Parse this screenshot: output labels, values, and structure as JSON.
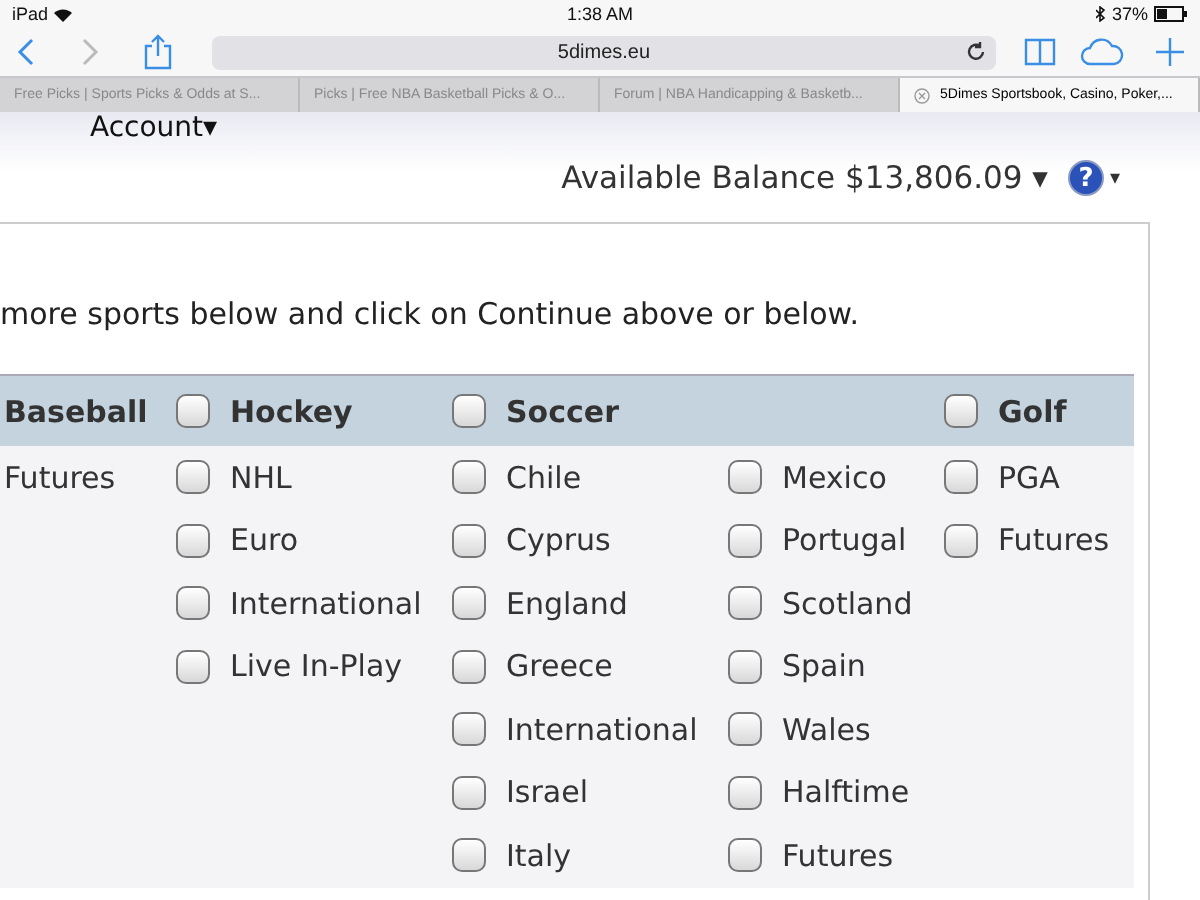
{
  "status_bar": {
    "device": "iPad",
    "time": "1:38 AM",
    "battery": "37%"
  },
  "toolbar": {
    "url": "5dimes.eu"
  },
  "tabs": [
    {
      "label": "Free Picks | Sports Picks & Odds at S...",
      "selected": false
    },
    {
      "label": "Picks | Free NBA Basketball Picks & O...",
      "selected": false
    },
    {
      "label": "Forum | NBA Handicapping & Basketb...",
      "selected": false
    },
    {
      "label": "5Dimes Sportsbook, Casino, Poker,...",
      "selected": true
    }
  ],
  "account_menu": {
    "label": "Account",
    "caret": "▾"
  },
  "balance": {
    "label": "Available Balance $13,806.09",
    "caret": "▾",
    "help_icon": "?",
    "help_caret": "▾"
  },
  "instructions": "more sports below and click on Continue above or below.",
  "sports": [
    {
      "header": {
        "label": "Baseball"
      },
      "items": [
        {
          "label": "Futures"
        }
      ]
    },
    {
      "header": {
        "label": "Hockey",
        "checked": false
      },
      "items": [
        {
          "label": "NHL",
          "checked": false
        },
        {
          "label": "Euro",
          "checked": false
        },
        {
          "label": "International",
          "checked": false
        },
        {
          "label": "Live In-Play",
          "checked": false
        }
      ]
    },
    {
      "header": {
        "label": "Soccer",
        "checked": false
      },
      "items": [
        {
          "label": "Chile",
          "checked": false
        },
        {
          "label": "Cyprus",
          "checked": false
        },
        {
          "label": "England",
          "checked": false
        },
        {
          "label": "Greece",
          "checked": false
        },
        {
          "label": "International",
          "checked": false
        },
        {
          "label": "Israel",
          "checked": false
        },
        {
          "label": "Italy",
          "checked": false
        }
      ]
    },
    {
      "items": [
        {
          "label": "Mexico",
          "checked": false
        },
        {
          "label": "Portugal",
          "checked": false
        },
        {
          "label": "Scotland",
          "checked": false
        },
        {
          "label": "Spain",
          "checked": false
        },
        {
          "label": "Wales",
          "checked": false
        },
        {
          "label": "Halftime",
          "checked": false
        },
        {
          "label": "Futures",
          "checked": false
        }
      ]
    },
    {
      "header": {
        "label": "Golf",
        "checked": false
      },
      "items": [
        {
          "label": "PGA",
          "checked": false
        },
        {
          "label": "Futures",
          "checked": false
        }
      ]
    }
  ]
}
